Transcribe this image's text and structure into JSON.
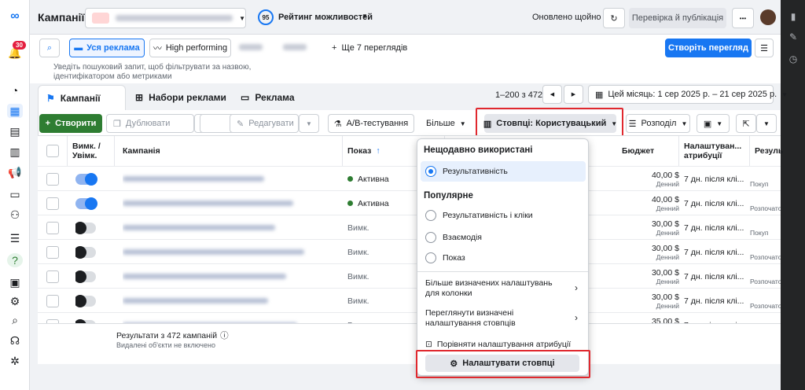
{
  "topbar": {
    "title": "Кампанії",
    "score": "95",
    "score_label": "Рейтинг можливостей",
    "updated": "Оновлено щойно",
    "publish": "Перевірка й публікація",
    "more": "•••"
  },
  "notifications": {
    "count": "30"
  },
  "views": {
    "all_ads": "Уся реклама",
    "high_performing": "High performing",
    "more_views": "Ще 7 переглядів",
    "create_view": "Створіть перегляд"
  },
  "search": {
    "placeholder": "Уведіть пошуковий запит, щоб фільтрувати за назвою, ідентифікатором або метриками"
  },
  "tabs": {
    "campaigns": "Кампанії",
    "adsets": "Набори реклами",
    "ads": "Реклама"
  },
  "pager": {
    "range": "1–200 з 472",
    "prev": "◀",
    "next": "▶"
  },
  "date_range": "Цей місяць: 1 сер 2025 р. – 21 сер 2025 р.",
  "toolbar": {
    "create": "Створити",
    "duplicate": "Дублювати",
    "edit": "Редагувати",
    "ab": "A/B-тестування",
    "more": "Більше",
    "columns": "Стовпці: Користувацький",
    "breakdown": "Розподіл"
  },
  "table": {
    "headers": {
      "toggle": "Вимк. / Увімк.",
      "campaign": "Кампанія",
      "delivery": "Показ",
      "budget": "Бюджет",
      "attribution": "Налаштуван... атрибуції",
      "results": "Резуль"
    },
    "rows": [
      {
        "status": "Активна",
        "budget": "40,00 $",
        "budget_type": "Денний",
        "attribution": "7 дн. після клі...",
        "result": "Покуп"
      },
      {
        "status": "Активна",
        "budget": "40,00 $",
        "budget_type": "Денний",
        "attribution": "7 дн. після клі...",
        "result": "Розпочато"
      },
      {
        "status": "Вимк.",
        "budget": "30,00 $",
        "budget_type": "Денний",
        "attribution": "7 дн. після клі...",
        "result": "Покуп"
      },
      {
        "status": "Вимк.",
        "budget": "30,00 $",
        "budget_type": "Денний",
        "attribution": "7 дн. після клі...",
        "result": "Розпочато"
      },
      {
        "status": "Вимк.",
        "budget": "30,00 $",
        "budget_type": "Денний",
        "attribution": "7 дн. після клі...",
        "result": "Розпочато"
      },
      {
        "status": "Вимк.",
        "budget": "30,00 $",
        "budget_type": "Денний",
        "attribution": "7 дн. після клі...",
        "result": "Розпочато"
      },
      {
        "status": "Вимк.",
        "budget": "35,00 $",
        "budget_type": "Денний",
        "attribution": "7 дн. після клі...",
        "result": "Розпочато"
      }
    ],
    "footer": {
      "results": "Результати з 472 кампаній",
      "note": "Видалені об'єкти не включено"
    }
  },
  "dropdown": {
    "recent_header": "Нещодавно використані",
    "recent_item": "Результативність",
    "popular_header": "Популярне",
    "popular": [
      "Результативність і кліки",
      "Взаємодія",
      "Показ"
    ],
    "more_presets": "Більше визначених налаштувань для колонки",
    "review_presets": "Переглянути визначені налаштування стовпців",
    "compare": "Порівняти налаштування атрибуції",
    "customize": "Налаштувати стовпці"
  },
  "colors": {
    "accent": "#1877f2",
    "green": "#2e7d32",
    "highlight": "#e0282e"
  }
}
